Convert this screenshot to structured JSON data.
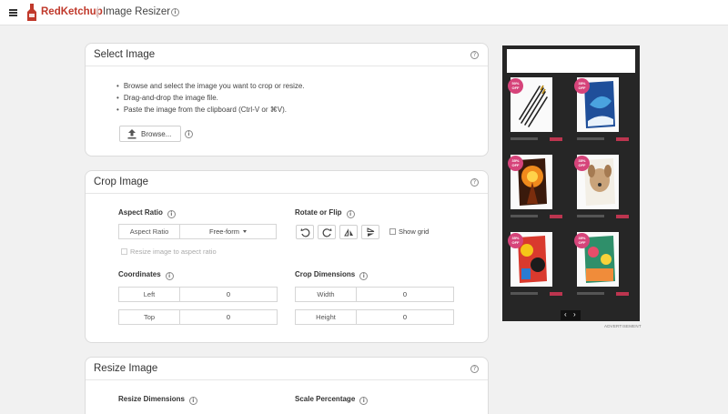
{
  "header": {
    "brand": "RedKetchup",
    "app_title": "Image Resizer",
    "menu_icon": "hamburger-menu-icon",
    "logo_icon": "ketchup-bottle-icon",
    "brand_color": "#c0392b"
  },
  "select_image": {
    "title": "Select Image",
    "instructions": [
      "Browse and select the image you want to crop or resize.",
      "Drag-and-drop the image file.",
      "Paste the image from the clipboard (Ctrl-V or ⌘V)."
    ],
    "browse_label": "Browse...",
    "browse_icon": "upload-icon"
  },
  "crop_image": {
    "title": "Crop Image",
    "aspect_ratio": {
      "heading": "Aspect Ratio",
      "label": "Aspect Ratio",
      "value": "Free-form",
      "resize_to_aspect_label": "Resize image to aspect ratio"
    },
    "rotate_flip": {
      "heading": "Rotate or Flip",
      "tools": [
        "rotate-left-icon",
        "rotate-right-icon",
        "flip-horizontal-icon",
        "flip-vertical-icon"
      ],
      "show_grid_label": "Show grid"
    },
    "coordinates": {
      "heading": "Coordinates",
      "left_label": "Left",
      "left_value": "0",
      "top_label": "Top",
      "top_value": "0"
    },
    "crop_dimensions": {
      "heading": "Crop Dimensions",
      "width_label": "Width",
      "width_value": "0",
      "height_label": "Height",
      "height_value": "0"
    }
  },
  "resize_image": {
    "title": "Resize Image",
    "resize_dimensions_heading": "Resize Dimensions",
    "scale_percentage_heading": "Scale Percentage"
  },
  "ad": {
    "caption": "ADVERTISEMENT",
    "badge_color": "#d6447a",
    "price_color": "#e23a5a",
    "tiles": [
      {
        "badge": "50% OFF"
      },
      {
        "badge": "35% OFF"
      },
      {
        "badge": "35% OFF"
      },
      {
        "badge": "35% OFF"
      },
      {
        "badge": "35% OFF"
      },
      {
        "badge": "35% OFF"
      }
    ],
    "prev_label": "‹",
    "next_label": "›"
  }
}
